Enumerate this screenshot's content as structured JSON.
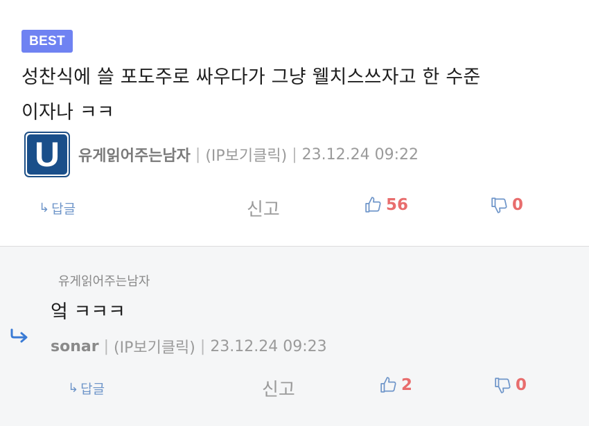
{
  "best_comment": {
    "badge": "BEST",
    "text_line1": "성찬식에 쓸 포도주로 싸우다가 그냥 웰치스쓰자고 한 수준",
    "text_line2": "이자나 ㅋㅋ",
    "author": "유게읽어주는남자",
    "ip_label": "(IP보기클릭)",
    "timestamp": "23.12.24 09:22",
    "separator": "|",
    "avatar_letter": "U",
    "actions": {
      "reply_label": "답글",
      "report_label": "신고",
      "like_count": "56",
      "dislike_count": "0"
    }
  },
  "reply_comment": {
    "reply_to": "유게읽어주는남자",
    "text": "엌 ㅋㅋㅋ",
    "author": "sonar",
    "ip_label": "(IP보기클릭)",
    "timestamp": "23.12.24 09:23",
    "separator": "|",
    "actions": {
      "reply_label": "답글",
      "report_label": "신고",
      "like_count": "2",
      "dislike_count": "0"
    }
  },
  "colors": {
    "badge": "#6f82f2",
    "link": "#6e95c9",
    "count": "#e86d6d",
    "avatar": "#1a4f8a",
    "reply_bg": "#f5f6f7"
  },
  "icons": {
    "reply": "reply-arrow-icon",
    "like": "thumbs-up-icon",
    "dislike": "thumbs-down-icon",
    "indent": "reply-indent-arrow-icon"
  }
}
